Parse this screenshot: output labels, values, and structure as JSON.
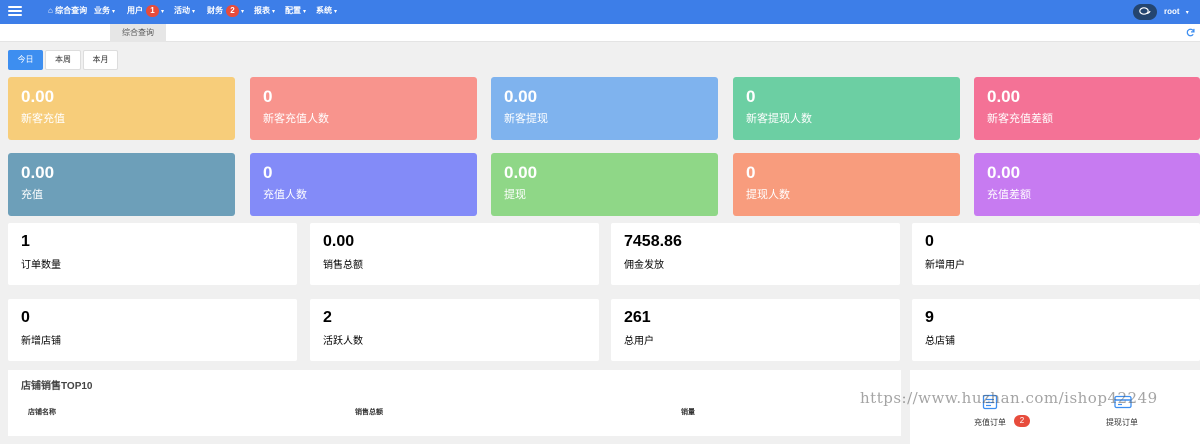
{
  "nav": {
    "items": [
      {
        "label": "综合查询",
        "icon": "home-icon"
      },
      {
        "label": "业务",
        "caret": "▾"
      },
      {
        "label": "用户",
        "badge": "1",
        "caret": "▾"
      },
      {
        "label": "活动",
        "caret": "▾"
      },
      {
        "label": "财务",
        "badge": "2",
        "caret": "▾"
      },
      {
        "label": "报表",
        "caret": "▾"
      },
      {
        "label": "配置",
        "caret": "▾"
      },
      {
        "label": "系统",
        "caret": "▾"
      }
    ],
    "user": "root",
    "user_caret": "▾",
    "accent": "#3d7ee8"
  },
  "tabs": {
    "active": "综合查询"
  },
  "period": {
    "today": "今日",
    "week": "本周",
    "month": "本月"
  },
  "color_cards": [
    {
      "value": "0.00",
      "label": "新客充值",
      "color": "#f7cd7a"
    },
    {
      "value": "0",
      "label": "新客充值人数",
      "color": "#f8948d"
    },
    {
      "value": "0.00",
      "label": "新客提现",
      "color": "#7fb3ee"
    },
    {
      "value": "0",
      "label": "新客提现人数",
      "color": "#6ccfa3"
    },
    {
      "value": "0.00",
      "label": "新客充值差额",
      "color": "#f47296"
    },
    {
      "value": "0.00",
      "label": "充值",
      "color": "#6d9fb9"
    },
    {
      "value": "0",
      "label": "充值人数",
      "color": "#838bf8"
    },
    {
      "value": "0.00",
      "label": "提现",
      "color": "#8fd787"
    },
    {
      "value": "0",
      "label": "提现人数",
      "color": "#f89c7d"
    },
    {
      "value": "0.00",
      "label": "充值差额",
      "color": "#c77bf1"
    }
  ],
  "white_cards": [
    {
      "value": "1",
      "label": "订单数量"
    },
    {
      "value": "0.00",
      "label": "销售总额"
    },
    {
      "value": "7458.86",
      "label": "佣金发放"
    },
    {
      "value": "0",
      "label": "新增用户"
    },
    {
      "value": "0",
      "label": "新增店铺"
    },
    {
      "value": "2",
      "label": "活跃人数"
    },
    {
      "value": "261",
      "label": "总用户"
    },
    {
      "value": "9",
      "label": "总店铺"
    }
  ],
  "top10": {
    "title": "店铺销售TOP10",
    "columns": [
      "店铺名称",
      "销售总额",
      "销量"
    ]
  },
  "quick": {
    "recharge_label": "充值订单",
    "recharge_badge": "2",
    "withdraw_label": "提现订单"
  },
  "watermark": "https://www.huzhan.com/ishop42249"
}
